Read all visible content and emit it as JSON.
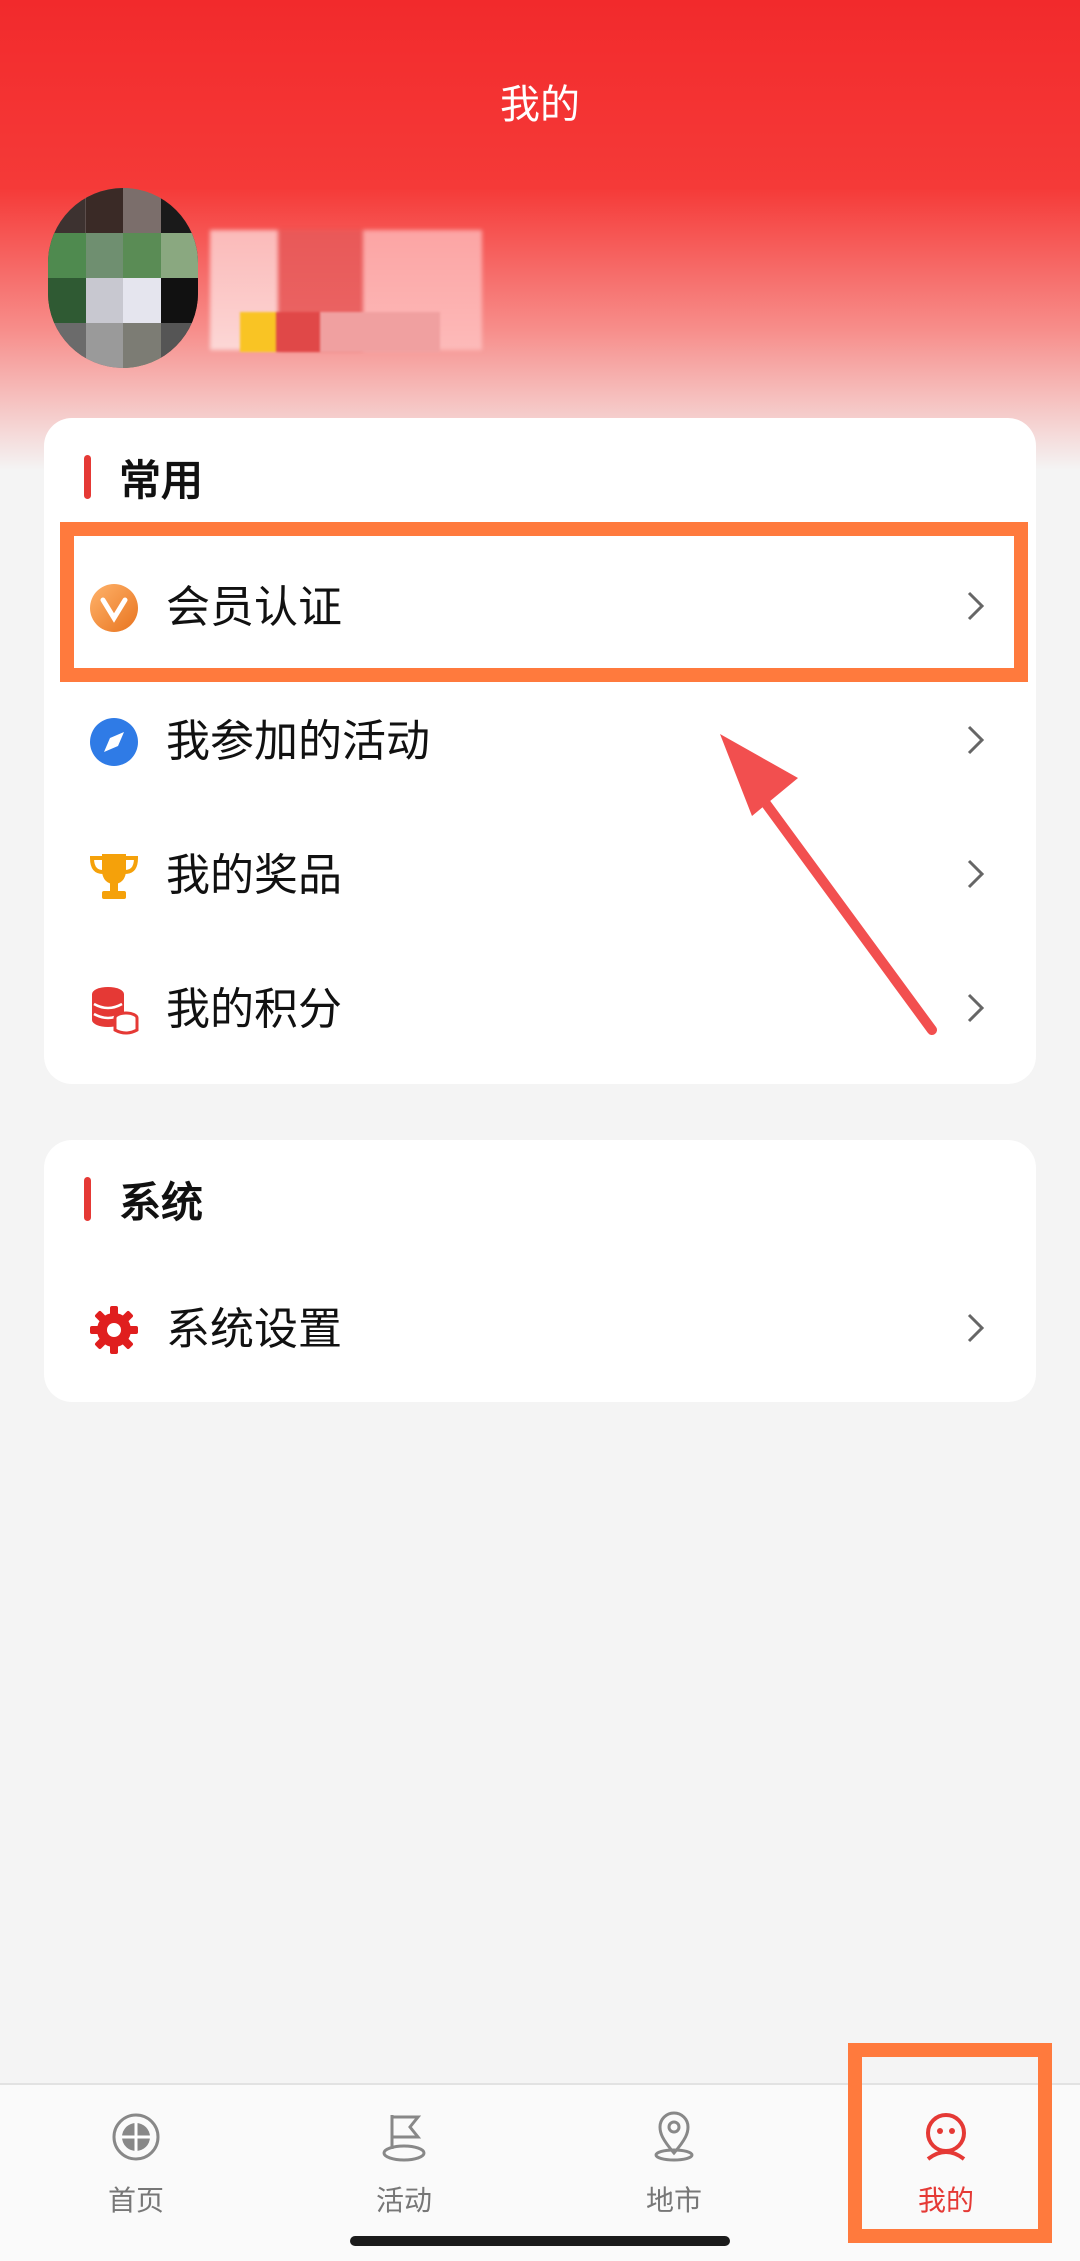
{
  "header": {
    "title": "我的"
  },
  "sections": [
    {
      "title": "常用",
      "items": [
        {
          "label": "会员认证",
          "icon": "vip-badge-icon"
        },
        {
          "label": "我参加的活动",
          "icon": "compass-icon"
        },
        {
          "label": "我的奖品",
          "icon": "trophy-icon"
        },
        {
          "label": "我的积分",
          "icon": "coins-icon"
        }
      ]
    },
    {
      "title": "系统",
      "items": [
        {
          "label": "系统设置",
          "icon": "gear-icon"
        }
      ]
    }
  ],
  "tabbar": {
    "tabs": [
      {
        "label": "首页",
        "icon": "home-icon",
        "active": false
      },
      {
        "label": "活动",
        "icon": "flag-icon",
        "active": false
      },
      {
        "label": "地市",
        "icon": "location-pin-icon",
        "active": false
      },
      {
        "label": "我的",
        "icon": "profile-face-icon",
        "active": true
      }
    ]
  },
  "colors": {
    "accent": "#e53935",
    "highlight": "#ff7a3d"
  }
}
